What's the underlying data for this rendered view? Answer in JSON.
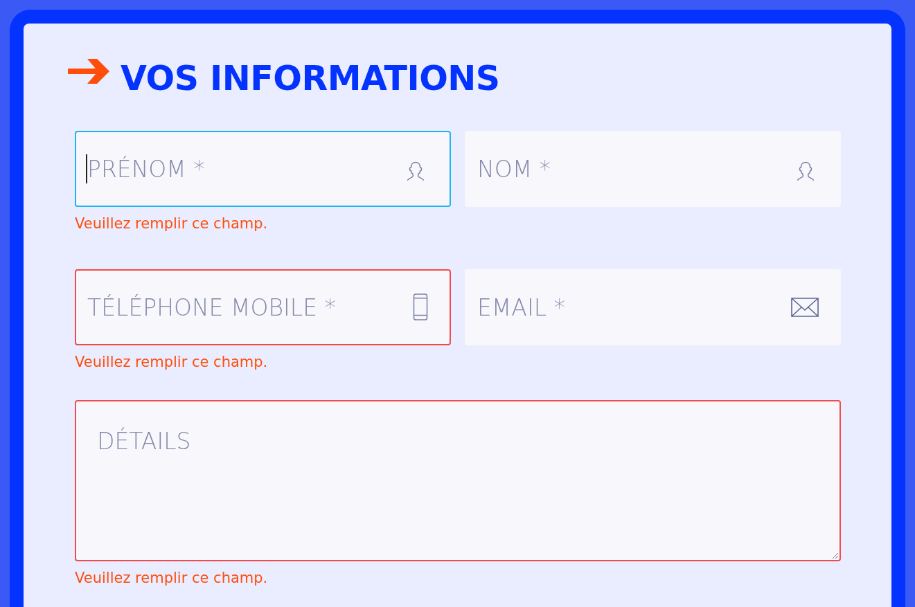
{
  "heading": {
    "title": "VOS INFORMATIONS"
  },
  "fields": [
    {
      "kind": "person",
      "placeholder": "PRÉNOM *",
      "focused": true,
      "error": "Veuillez remplir ce champ."
    },
    {
      "kind": "person",
      "placeholder": "NOM *",
      "focused": false,
      "invalid": false
    },
    {
      "kind": "phone",
      "placeholder": "TÉLÉPHONE MOBILE *",
      "focused": false,
      "invalid": true,
      "error": "Veuillez remplir ce champ."
    },
    {
      "kind": "mail",
      "placeholder": "EMAIL *",
      "focused": false,
      "invalid": false
    },
    {
      "kind": "textarea",
      "placeholder": "DÉTAILS",
      "focused": false,
      "invalid": true,
      "error": "Veuillez remplir ce champ."
    }
  ]
}
